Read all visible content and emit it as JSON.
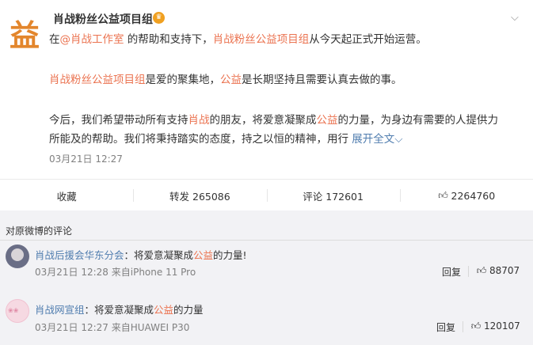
{
  "post": {
    "avatar_glyph": "益",
    "username": "肖战粉丝公益项目组",
    "badge_icon": "crown-icon",
    "menu_icon": "chevron-down-icon",
    "line1": {
      "p1": "在",
      "mention": "@肖战工作室",
      "p2": " 的帮助和支持下，",
      "org": "肖战粉丝公益项目组",
      "p3": "从今天起正式开始运营。"
    },
    "line2": {
      "org": "肖战粉丝公益项目组",
      "p1": "是爱的聚集地，",
      "kw": "公益",
      "p2": "是长期坚持且需要认真去做的事。"
    },
    "line3": {
      "p1": "今后，我们希望带动所有支持",
      "kw1": "肖战",
      "p2": "的朋友，将爱意凝聚成",
      "kw2": "公益",
      "p3": "的力量，为身边有需要的人提供力"
    },
    "line4": {
      "p1": "所能及的帮助。我们将秉持踏实的态度，持之以恒的精神，用行",
      "expand": "展开全文"
    },
    "timestamp": "03月21日 12:27"
  },
  "actions": {
    "favorite": "收藏",
    "repost": "转发 265086",
    "comment": "评论 172601",
    "like_count": "2264760"
  },
  "comments": {
    "title": "对原微博的评论",
    "items": [
      {
        "name": "肖战后援会华东分会",
        "sep": "：将爱意凝聚成",
        "kw": "公益",
        "tail": "的力量!",
        "meta": "03月21日 12:28 来自iPhone 11 Pro",
        "reply": "回复",
        "likes": "88707"
      },
      {
        "name": "肖战网宣组",
        "sep": "：将爱意凝聚成",
        "kw": "公益",
        "tail": "的力量",
        "meta": "03月21日 12:27 来自HUAWEI P30",
        "reply": "回复",
        "likes": "120107"
      }
    ]
  },
  "colors": {
    "keyword": "#eb7350",
    "link": "#507daf",
    "comments_bg": "#f2f2f5"
  }
}
